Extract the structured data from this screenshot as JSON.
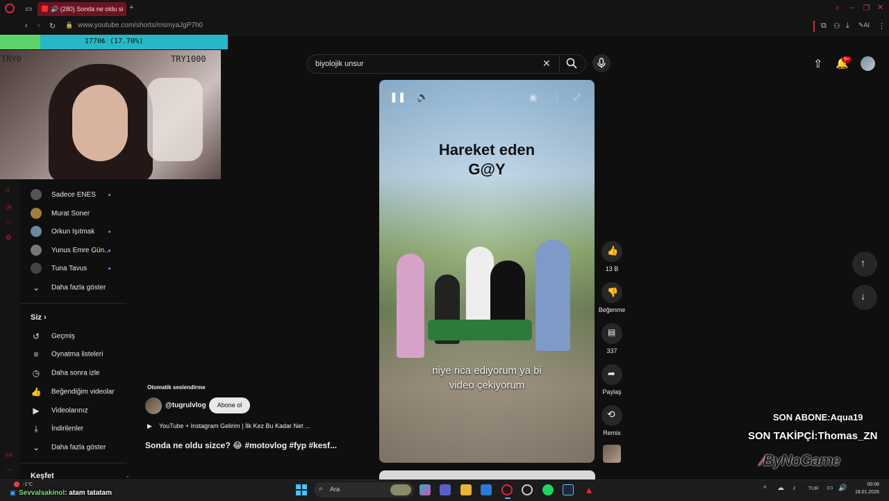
{
  "browser": {
    "tab_title": "(280) Sonda ne oldu si",
    "url": "www.youtube.com/shorts/msmyaJgP7h0",
    "ai_label": "AI"
  },
  "stream_overlay": {
    "goal_text": "1770₺ (17.70%)",
    "goal_fraction": 0.177,
    "goal_min": "TRY0",
    "goal_max": "TRY1000",
    "last_subscriber": "SON ABONE:Aqua19",
    "last_follower": "SON TAKİPÇİ:Thomas_ZN",
    "brand": "ByNoGame",
    "chat_user": "Sevvalsakinol",
    "chat_message": ": atam tatatam"
  },
  "search": {
    "value": "biyolojik unsur"
  },
  "notifications": {
    "badge": "9+"
  },
  "sidebar": {
    "subscriptions": [
      {
        "label": "Sadece ENES",
        "dot": true,
        "color": "#555"
      },
      {
        "label": "Murat Soner",
        "dot": false,
        "color": "#a08040"
      },
      {
        "label": "Orkun Işıtmak",
        "dot": true,
        "color": "#6a8aa0"
      },
      {
        "label": "Yunus Emre Gün...",
        "dot": true,
        "color": "#777"
      },
      {
        "label": "Tuna Tavus",
        "dot": true,
        "color": "#444"
      }
    ],
    "show_more_1": "Daha fazla göster",
    "you_header": "Siz",
    "you_items": [
      {
        "label": "Geçmiş",
        "icon": "history-icon",
        "glyph": "↺"
      },
      {
        "label": "Oynatma listeleri",
        "icon": "playlists-icon",
        "glyph": "≡"
      },
      {
        "label": "Daha sonra izle",
        "icon": "watch-later-icon",
        "glyph": "◷"
      },
      {
        "label": "Beğendiğim videolar",
        "icon": "liked-icon",
        "glyph": "👍"
      },
      {
        "label": "Videolarınız",
        "icon": "your-videos-icon",
        "glyph": "▶"
      },
      {
        "label": "İndirilenler",
        "icon": "downloads-icon",
        "glyph": "⤓"
      }
    ],
    "show_more_2": "Daha fazla göster",
    "explore_header": "Keşfet"
  },
  "video": {
    "title_line1": "Hareket eden",
    "title_line2": "G@Y",
    "subtitle_line1": "niye rica ediyorum ya bi",
    "subtitle_line2": "video çekiyorum"
  },
  "meta": {
    "auto_dub": "Otomatik seslendirme",
    "channel": "@tugrulvlog",
    "subscribe": "Abone ol",
    "related": "YouTube + Instagram Gelirim | İlk Kez Bu Kadar Net ...",
    "caption": "Sonda ne oldu sizce? 😂 #motovlog #fyp #kesf..."
  },
  "actions": {
    "likes": "13 B",
    "dislike": "Beğenme",
    "comments": "337",
    "share": "Paylaş",
    "remix": "Remix"
  },
  "taskbar": {
    "weather": "-1°C",
    "search_placeholder": "Ara",
    "lang": "TUR",
    "time": "00:06",
    "date": "18.01.2026"
  }
}
